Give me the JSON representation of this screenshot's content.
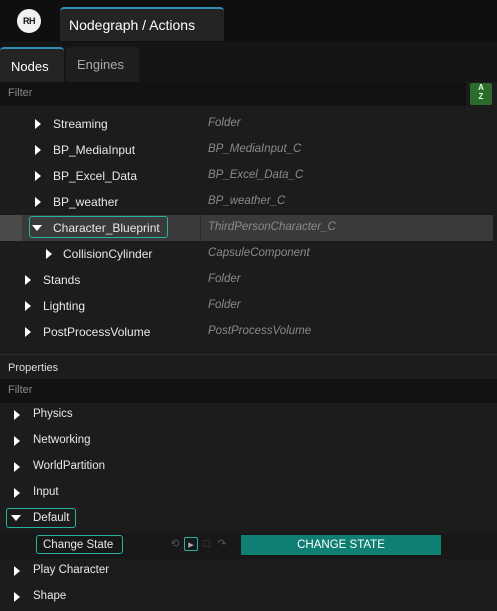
{
  "app": {
    "logo_text": "RH",
    "window_tab": "Nodegraph / Actions"
  },
  "tabs": [
    {
      "label": "Nodes",
      "active": true
    },
    {
      "label": "Engines",
      "active": false
    }
  ],
  "nodes_filter": {
    "placeholder": "Filter",
    "sort_icon": "sort-a-z-icon"
  },
  "tree": [
    {
      "name": "Streaming",
      "type": "Folder"
    },
    {
      "name": "BP_MediaInput",
      "type": "BP_MediaInput_C"
    },
    {
      "name": "BP_Excel_Data",
      "type": "BP_Excel_Data_C"
    },
    {
      "name": "BP_weather",
      "type": "BP_weather_C"
    },
    {
      "name": "Character_Blueprint",
      "type": "ThirdPersonCharacter_C",
      "expanded": true,
      "selected": true
    },
    {
      "name": "CollisionCylinder",
      "type": "CapsuleComponent"
    },
    {
      "name": "Stands",
      "type": "Folder"
    },
    {
      "name": "Lighting",
      "type": "Folder"
    },
    {
      "name": "PostProcessVolume",
      "type": "PostProcessVolume"
    }
  ],
  "properties": {
    "title": "Properties",
    "filter_placeholder": "Filter",
    "categories": [
      "Physics",
      "Networking",
      "WorldPartition",
      "Input",
      "Default",
      "Play Character",
      "Shape"
    ],
    "change_state": {
      "label": "Change State",
      "button": "CHANGE STATE"
    }
  },
  "colors": {
    "accent_tab": "#2f8fb2",
    "focus_outline": "#27b3a0",
    "action_button": "#107f73",
    "sort_button": "#2d6b2d"
  }
}
